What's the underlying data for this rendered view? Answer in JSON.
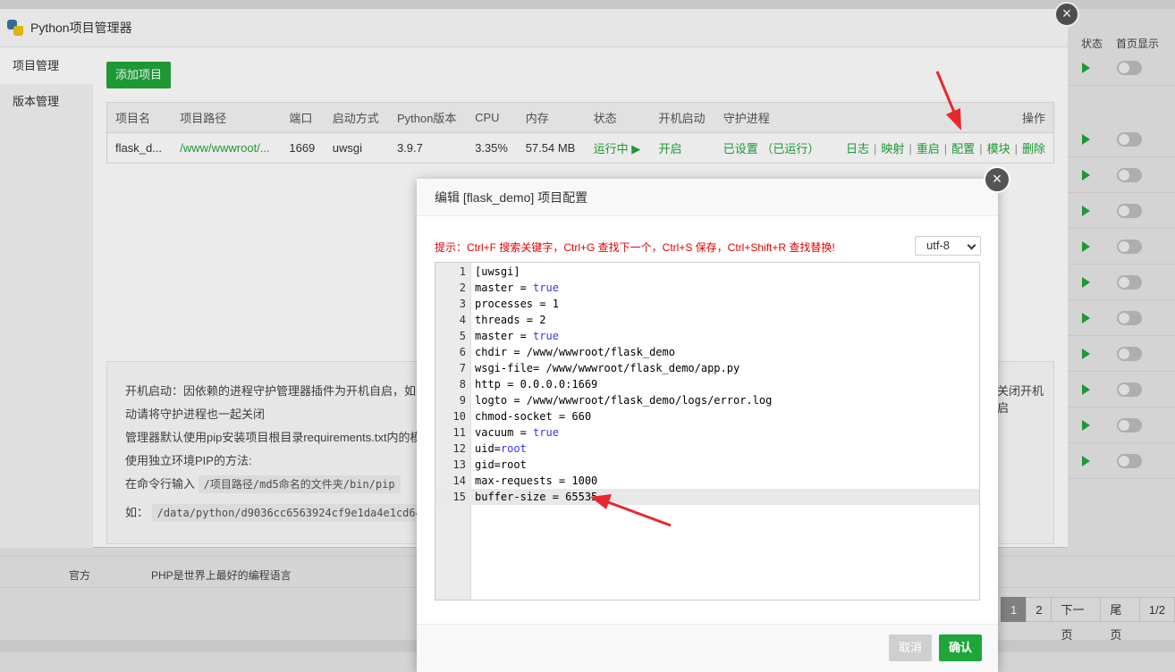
{
  "background": {
    "right_headers": [
      "状态",
      "首页显示"
    ],
    "bottom_row": {
      "col1": "官方",
      "col2": "PHP是世界上最好的编程语言"
    },
    "pager": [
      "1",
      "2",
      "下一页",
      "尾页",
      "1/2"
    ]
  },
  "manager": {
    "title": "Python项目管理器",
    "sidebar": [
      {
        "label": "项目管理"
      },
      {
        "label": "版本管理"
      }
    ],
    "add_button": "添加项目",
    "table": {
      "headers": [
        "项目名",
        "项目路径",
        "端口",
        "启动方式",
        "Python版本",
        "CPU",
        "内存",
        "状态",
        "开机启动",
        "守护进程",
        "操作"
      ],
      "row": {
        "name": "flask_d...",
        "path": "/www/wwwroot/...",
        "port": "1669",
        "start_mode": "uwsgi",
        "python_version": "3.9.7",
        "cpu": "3.35%",
        "memory": "57.54 MB",
        "status": "运行中",
        "autostart": "开启",
        "daemon": "已设置 （已运行）",
        "ops": [
          "日志",
          "映射",
          "重启",
          "配置",
          "模块",
          "删除"
        ]
      }
    },
    "tips": {
      "line1": "开机启动：因依赖的进程守护管理器插件为开机自启，如关闭开",
      "line1_tail": "关闭开机启",
      "line2": "动请将守护进程也一起关闭",
      "line3": "管理器默认使用pip安装项目根目录requirements.txt内的模块",
      "line4": "使用独立环境PIP的方法:",
      "line5_prefix": "在命令行输入",
      "line5_code": "/项目路径/md5命名的文件夹/bin/pip",
      "line6_prefix": "如：",
      "line6_code": "/data/python/d9036cc6563924cf9e1da4e1cd64f9a4"
    }
  },
  "dialog": {
    "title": "编辑 [flask_demo] 项目配置",
    "tip": "提示：Ctrl+F 搜索关键字，Ctrl+G 查找下一个，Ctrl+S 保存，Ctrl+Shift+R 查找替换!",
    "encoding": "utf-8",
    "lines": [
      {
        "n": "1",
        "pre": "[uwsgi]",
        "kw": ""
      },
      {
        "n": "2",
        "pre": "master = ",
        "kw": "true"
      },
      {
        "n": "3",
        "pre": "processes = 1",
        "kw": ""
      },
      {
        "n": "4",
        "pre": "threads = 2",
        "kw": ""
      },
      {
        "n": "5",
        "pre": "master = ",
        "kw": "true"
      },
      {
        "n": "6",
        "pre": "chdir = /www/wwwroot/flask_demo",
        "kw": ""
      },
      {
        "n": "7",
        "pre": "wsgi-file= /www/wwwroot/flask_demo/app.py",
        "kw": ""
      },
      {
        "n": "8",
        "pre": "http = 0.0.0.0:1669",
        "kw": ""
      },
      {
        "n": "9",
        "pre": "logto = /www/wwwroot/flask_demo/logs/error.log",
        "kw": ""
      },
      {
        "n": "10",
        "pre": "chmod-socket = 660",
        "kw": ""
      },
      {
        "n": "11",
        "pre": "vacuum = ",
        "kw": "true"
      },
      {
        "n": "12",
        "pre": "uid=",
        "kw": "root"
      },
      {
        "n": "13",
        "pre": "gid=root",
        "kw": ""
      },
      {
        "n": "14",
        "pre": "max-requests = 1000",
        "kw": ""
      },
      {
        "n": "15",
        "pre": "buffer-size = 65535",
        "kw": ""
      }
    ],
    "cancel": "取消",
    "confirm": "确认"
  }
}
